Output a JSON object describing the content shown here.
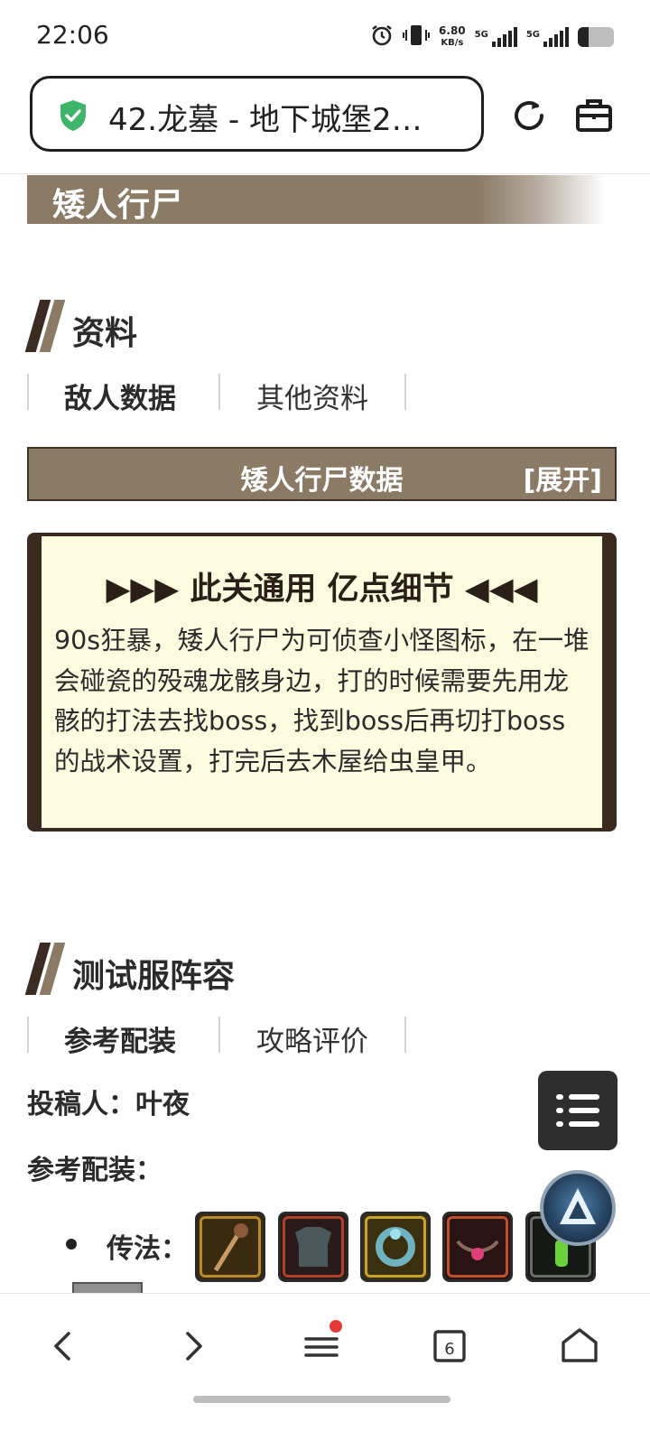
{
  "status_bar": {
    "time": "22:06",
    "net_speed_value": "6.80",
    "net_speed_unit": "KB/s",
    "sim1_label": "5G",
    "sim2_label": "5G",
    "battery_level": 0.3
  },
  "browser": {
    "url_title": "42.龙墓 - 地下城堡2…",
    "secure": true
  },
  "page": {
    "boss_banner": "矮人行尸",
    "section1": {
      "title": "资料",
      "tabs": [
        {
          "label": "敌人数据",
          "active": true
        },
        {
          "label": "其他资料",
          "active": false
        }
      ],
      "data_bar_title": "矮人行尸数据",
      "data_bar_expand": "[展开]"
    },
    "tip": {
      "title": "▶▶▶ 此关通用 亿点细节 ◀◀◀",
      "body": "90s狂暴，矮人行尸为可侦查小怪图标，在一堆会碰瓷的殁魂龙骸身边，打的时候需要先用龙骸的打法去找boss，找到boss后再切打boss的战术设置，打完后去木屋给虫皇甲。"
    },
    "section2": {
      "title": "测试服阵容",
      "tabs": [
        {
          "label": "参考配装",
          "active": true
        },
        {
          "label": "攻略评价",
          "active": false
        }
      ],
      "contributor_label": "投稿人：叶夜",
      "gear_label": "参考配装：",
      "class_label": "传法："
    },
    "gear_icons": [
      "staff-icon",
      "armor-icon",
      "ring-icon",
      "amulet-icon",
      "relic-icon"
    ]
  },
  "nav": {
    "tab_count": "6"
  },
  "colors": {
    "banner_brown": "#8a7a66",
    "dark_brown": "#3b2a20",
    "tip_bg": "#fdfbe0",
    "shield_green": "#3db56a",
    "notify_red": "#e53935"
  }
}
